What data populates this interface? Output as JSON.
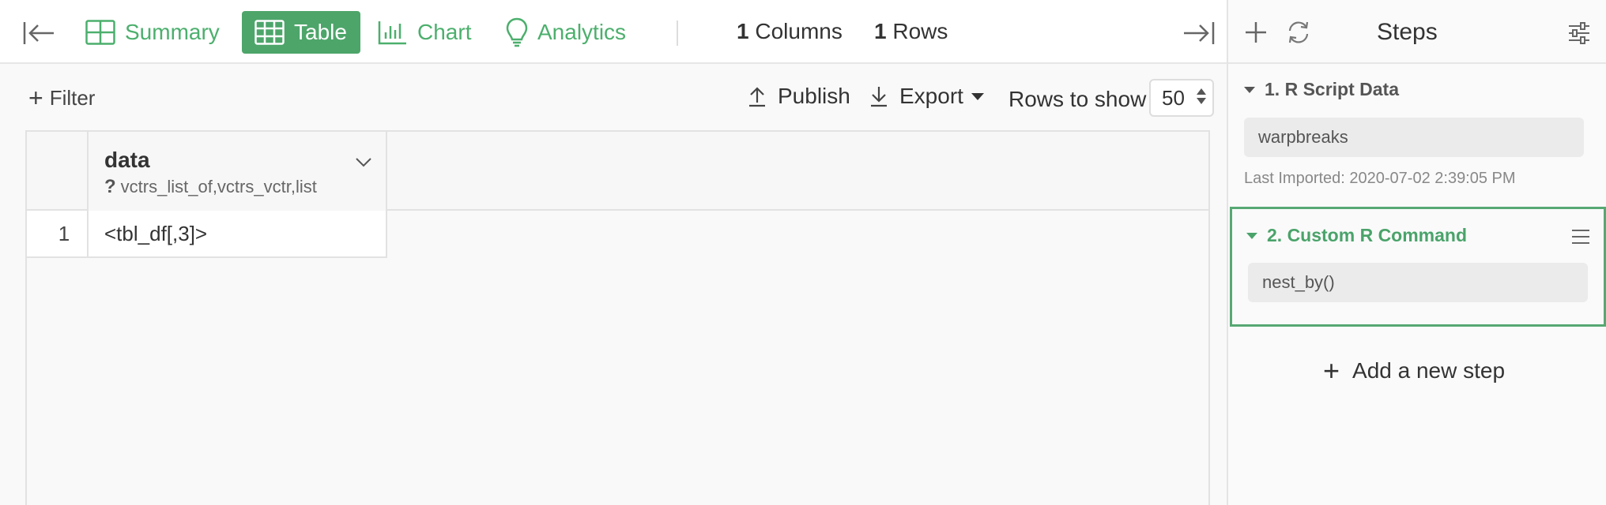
{
  "header": {
    "tabs": [
      {
        "label": "Summary",
        "icon": "summary-grid-icon"
      },
      {
        "label": "Table",
        "icon": "table-icon",
        "active": true
      },
      {
        "label": "Chart",
        "icon": "bar-chart-icon"
      },
      {
        "label": "Analytics",
        "icon": "lightbulb-icon"
      }
    ],
    "columns_count": "1",
    "columns_label": "Columns",
    "rows_count": "1",
    "rows_label": "Rows"
  },
  "toolbar": {
    "filter_label": "Filter",
    "publish_label": "Publish",
    "export_label": "Export",
    "rows_to_show_label": "Rows to show",
    "rows_to_show_value": "50"
  },
  "table": {
    "columns": [
      {
        "name": "data",
        "type": "vctrs_list_of,vctrs_vctr,list",
        "type_icon": "question-mark"
      }
    ],
    "rows": [
      {
        "num": "1",
        "cells": [
          "<tbl_df[,3]>"
        ]
      }
    ]
  },
  "steps_panel": {
    "title": "Steps",
    "steps": [
      {
        "title": "1. R Script Data",
        "value": "warpbreaks",
        "meta": "Last Imported: 2020-07-02 2:39:05 PM"
      },
      {
        "title": "2. Custom R Command",
        "value": "nest_by()",
        "selected": true
      }
    ],
    "add_step_label": "Add a new step"
  },
  "colors": {
    "accent": "#4da56a",
    "selected_border": "#57a873"
  }
}
